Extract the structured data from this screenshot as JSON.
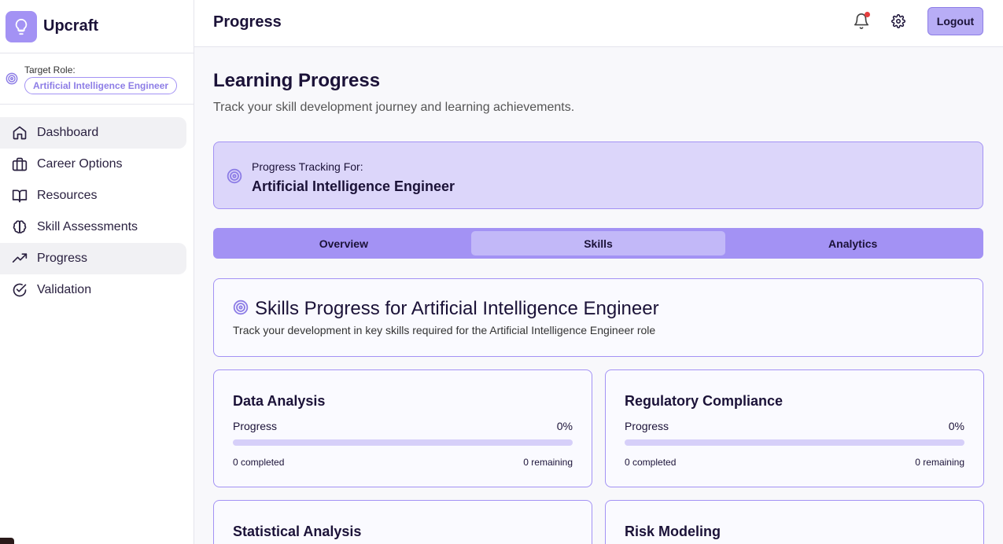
{
  "app": {
    "name": "Upcraft",
    "logo_icon": "lightbulb-icon"
  },
  "sidebar": {
    "target_role_label": "Target Role:",
    "target_role_value": "Artificial Intelligence Engineer",
    "items": [
      {
        "label": "Dashboard",
        "icon": "home-icon"
      },
      {
        "label": "Career Options",
        "icon": "briefcase-icon"
      },
      {
        "label": "Resources",
        "icon": "book-icon"
      },
      {
        "label": "Skill Assessments",
        "icon": "brain-icon"
      },
      {
        "label": "Progress",
        "icon": "trending-up-icon",
        "active": true
      },
      {
        "label": "Validation",
        "icon": "check-circle-icon"
      }
    ]
  },
  "header": {
    "title": "Progress",
    "logout_label": "Logout"
  },
  "main": {
    "title": "Learning Progress",
    "subtitle": "Track your skill development journey and learning achievements.",
    "tracking_label": "Progress Tracking For:",
    "tracking_value": "Artificial Intelligence Engineer",
    "tabs": [
      {
        "label": "Overview"
      },
      {
        "label": "Skills",
        "active": true
      },
      {
        "label": "Analytics"
      }
    ],
    "skills_title": "Skills Progress for Artificial Intelligence Engineer",
    "skills_subtitle": "Track your development in key skills required for the Artificial Intelligence Engineer role",
    "skills": [
      {
        "name": "Data Analysis",
        "progress_label": "Progress",
        "progress_value": "0%",
        "progress": 0,
        "completed": "0 completed",
        "remaining": "0 remaining"
      },
      {
        "name": "Regulatory Compliance",
        "progress_label": "Progress",
        "progress_value": "0%",
        "progress": 0,
        "completed": "0 completed",
        "remaining": "0 remaining"
      },
      {
        "name": "Statistical Analysis"
      },
      {
        "name": "Risk Modeling"
      }
    ]
  },
  "colors": {
    "accent": "#a392f4",
    "accent_dark": "#8d7de6",
    "text": "#1b1238",
    "notification": "#e53e3e"
  }
}
